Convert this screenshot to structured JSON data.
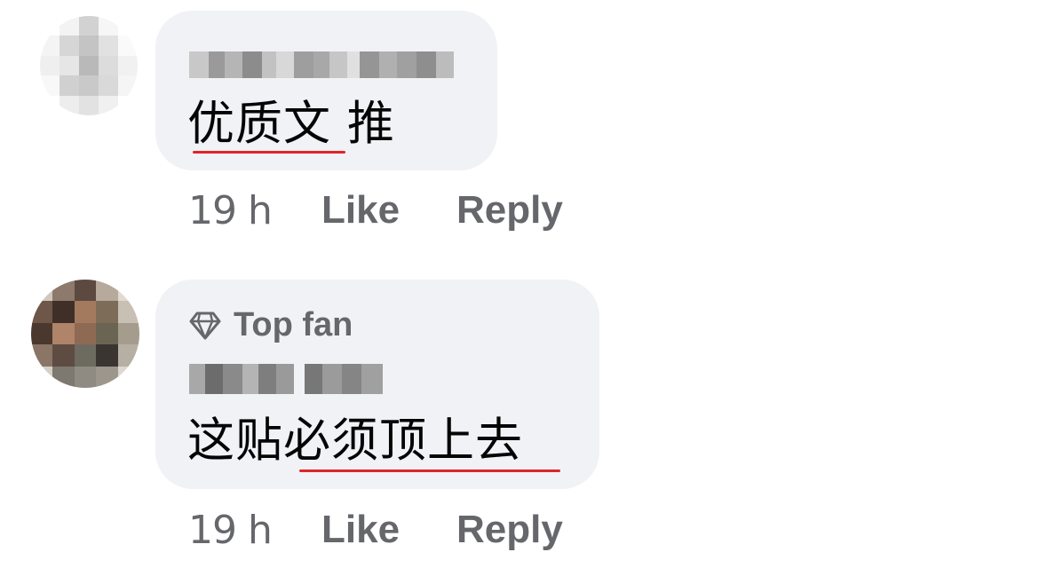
{
  "comments": [
    {
      "text": "优质文 推",
      "time": "19 h",
      "like_label": "Like",
      "reply_label": "Reply"
    },
    {
      "badge_icon": "diamond-icon",
      "badge_label": "Top fan",
      "text": "这贴必须顶上去",
      "time": "19 h",
      "like_label": "Like",
      "reply_label": "Reply"
    }
  ],
  "colors": {
    "bubble": "#f0f2f5",
    "meta_text": "#65676b",
    "spellcheck_underline": "#e0242a"
  }
}
